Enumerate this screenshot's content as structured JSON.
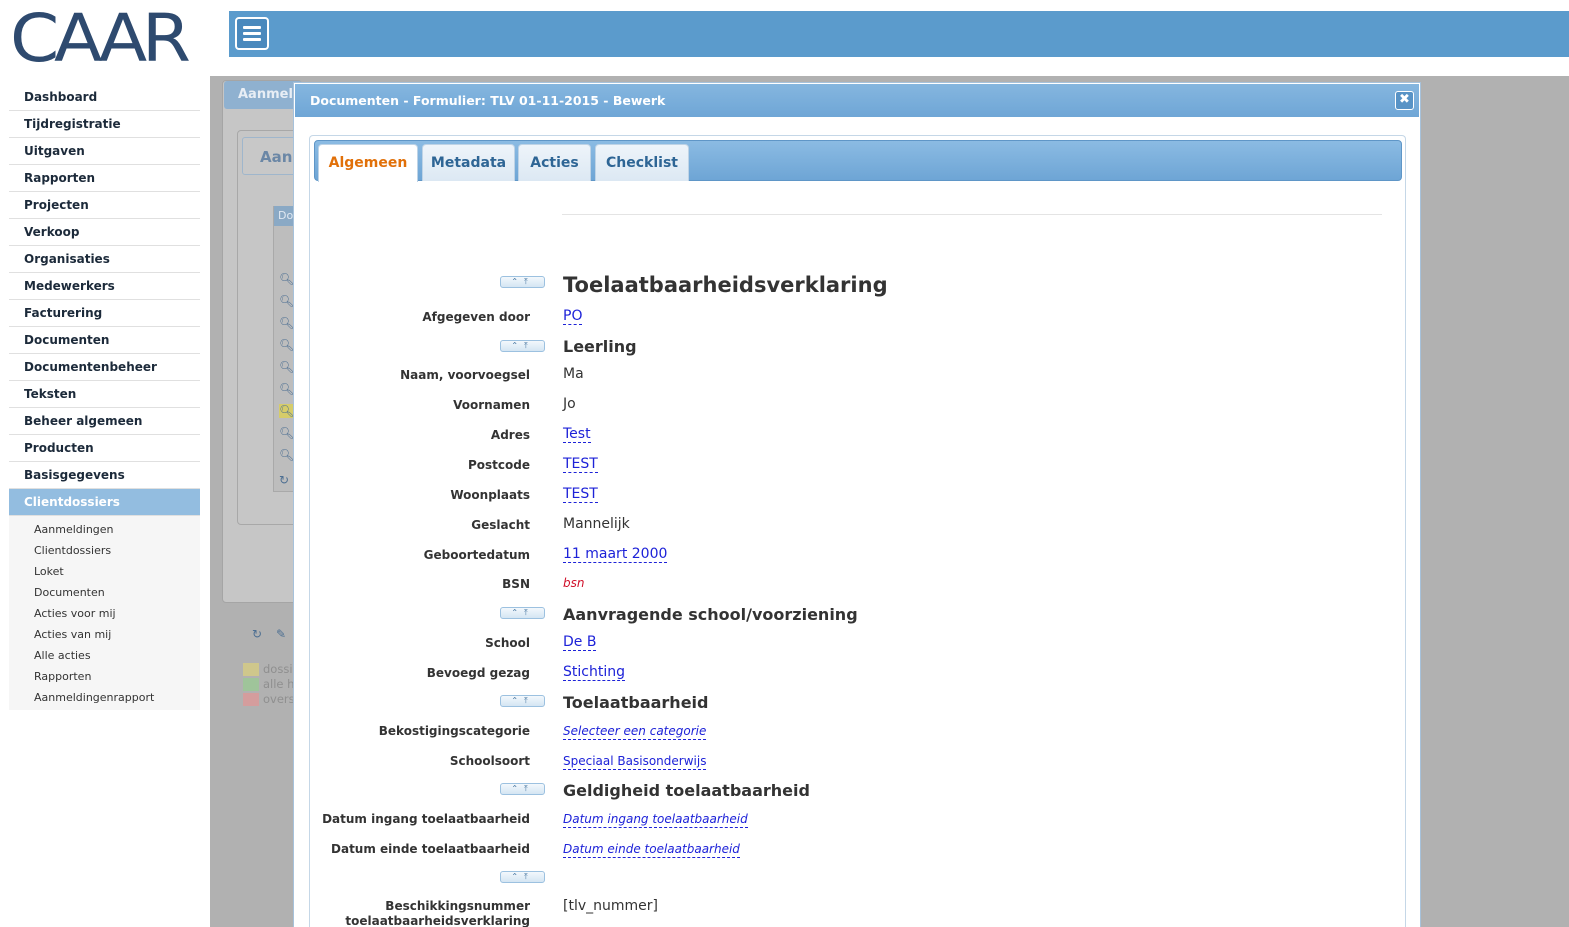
{
  "logo": {
    "text": "CAAR"
  },
  "sidebar": {
    "items": [
      {
        "label": "Dashboard"
      },
      {
        "label": "Tijdregistratie"
      },
      {
        "label": "Uitgaven"
      },
      {
        "label": "Rapporten"
      },
      {
        "label": "Projecten"
      },
      {
        "label": "Verkoop"
      },
      {
        "label": "Organisaties"
      },
      {
        "label": "Medewerkers"
      },
      {
        "label": "Facturering"
      },
      {
        "label": "Documenten"
      },
      {
        "label": "Documentenbeheer"
      },
      {
        "label": "Teksten"
      },
      {
        "label": "Beheer algemeen"
      },
      {
        "label": "Producten"
      },
      {
        "label": "Basisgegevens"
      },
      {
        "label": "Clientdossiers"
      }
    ],
    "subitems": [
      {
        "label": "Aanmeldingen"
      },
      {
        "label": "Clientdossiers"
      },
      {
        "label": "Loket"
      },
      {
        "label": "Documenten"
      },
      {
        "label": "Acties voor mij"
      },
      {
        "label": "Acties van mij"
      },
      {
        "label": "Alle acties"
      },
      {
        "label": "Rapporten"
      },
      {
        "label": "Aanmeldingenrapport"
      }
    ]
  },
  "background": {
    "header": "Aanmelding",
    "tab": "Aanmelding",
    "grid_header": "Do",
    "legend": [
      "dossier",
      "alle h",
      "overs"
    ]
  },
  "dialog": {
    "title": "Documenten - Formulier: TLV 01-11-2015 - Bewerk",
    "close_icon": "close-icon",
    "tabs": [
      "Algemeen",
      "Metadata",
      "Acties",
      "Checklist"
    ],
    "form": {
      "doc_title": "Toelaatbaarheidsverklaring",
      "afgegeven_door": {
        "label": "Afgegeven door",
        "value": "PO"
      },
      "leerling": {
        "title": "Leerling",
        "naam": {
          "label": "Naam, voorvoegsel",
          "value": "Ma"
        },
        "voornamen": {
          "label": "Voornamen",
          "value": "Jo"
        },
        "adres": {
          "label": "Adres",
          "value": "Test"
        },
        "postcode": {
          "label": "Postcode",
          "value": "TEST"
        },
        "woonplaats": {
          "label": "Woonplaats",
          "value": "TEST"
        },
        "geslacht": {
          "label": "Geslacht",
          "value": "Mannelijk"
        },
        "geboortedatum": {
          "label": "Geboortedatum",
          "value": "11 maart 2000"
        },
        "bsn": {
          "label": "BSN",
          "value": "bsn"
        }
      },
      "school_section": {
        "title": "Aanvragende school/voorziening",
        "school": {
          "label": "School",
          "value": "De B"
        },
        "gezag": {
          "label": "Bevoegd gezag",
          "value": "Stichting"
        }
      },
      "toelaatbaarheid": {
        "title": "Toelaatbaarheid",
        "bekostiging": {
          "label": "Bekostigingscategorie",
          "value": "Selecteer een categorie"
        },
        "schoolsoort": {
          "label": "Schoolsoort",
          "value": "Speciaal Basisonderwijs"
        }
      },
      "geldigheid": {
        "title": "Geldigheid toelaatbaarheid",
        "ingang": {
          "label": "Datum ingang toelaatbaarheid",
          "value": "Datum ingang toelaatbaarheid"
        },
        "einde": {
          "label": "Datum einde toelaatbaarheid",
          "value": "Datum einde toelaatbaarheid"
        }
      },
      "beschikking": {
        "label_line1": "Beschikkingsnummer",
        "label_line2": "toelaatbaarheidsverklaring",
        "value": "[tlv_nummer]"
      }
    }
  }
}
